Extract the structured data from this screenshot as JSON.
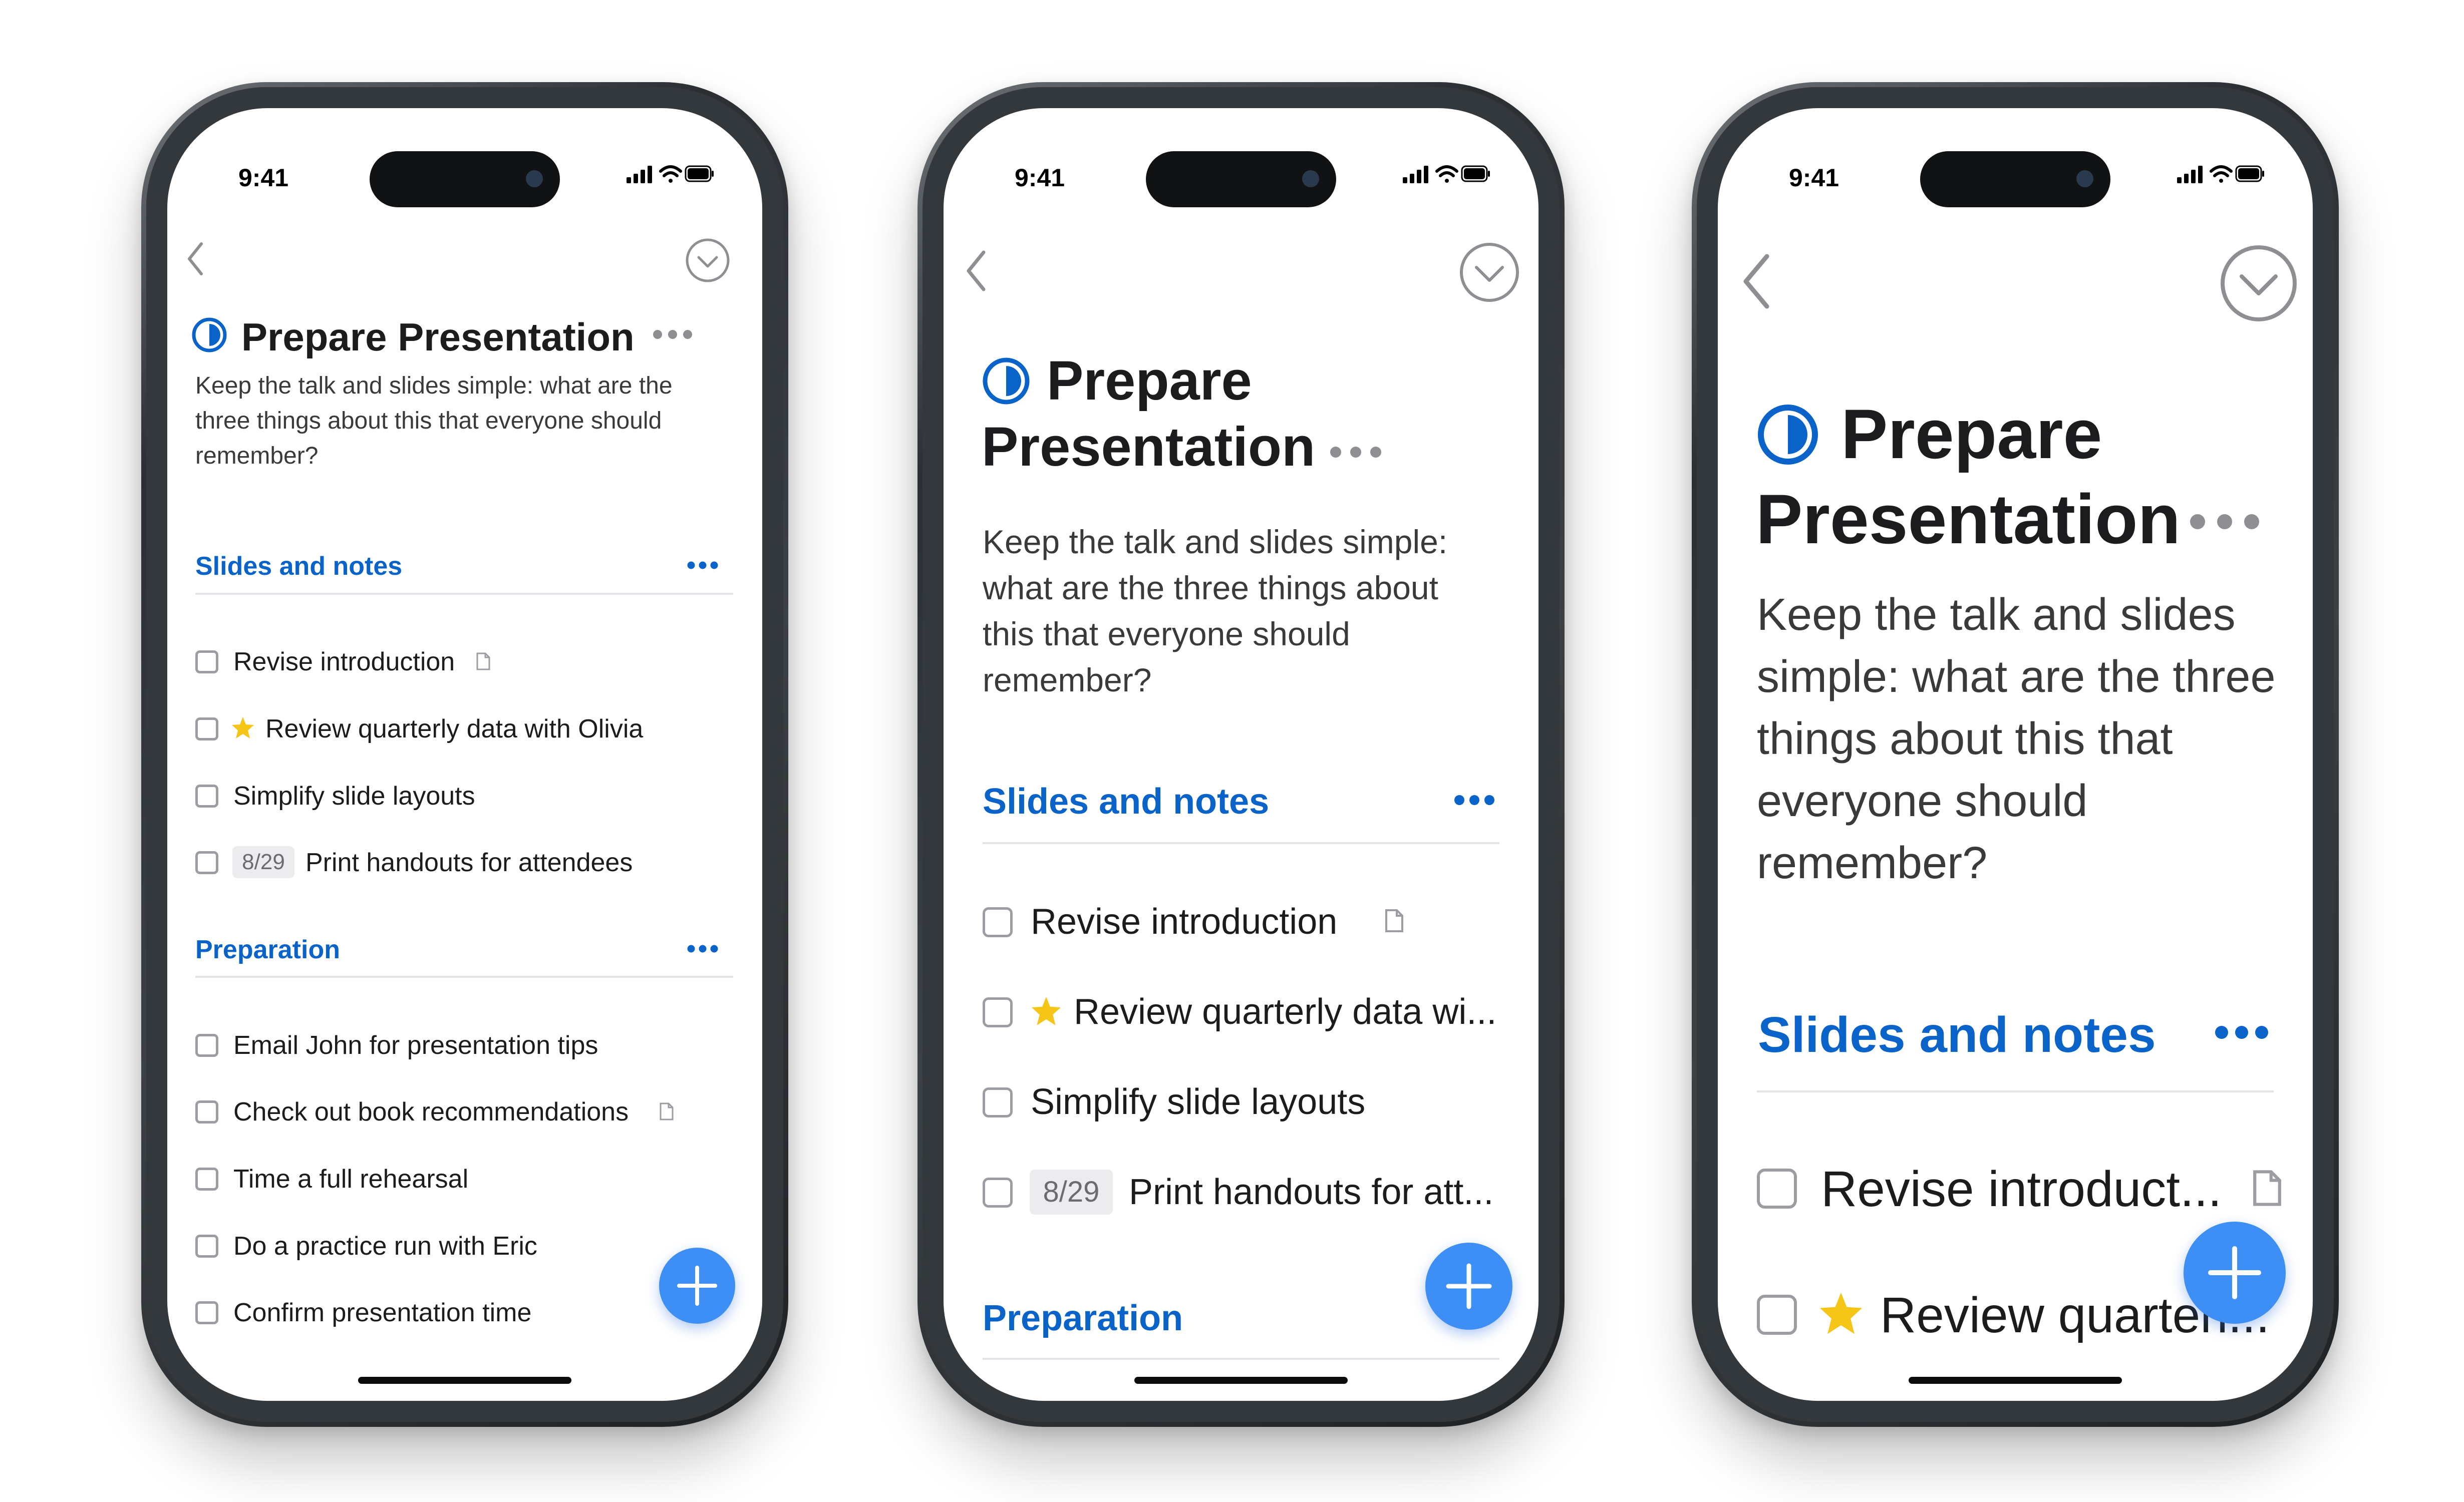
{
  "status": {
    "time": "9:41"
  },
  "task": {
    "title": "Prepare Presentation",
    "title_line1": "Prepare",
    "title_line2": "Presentation",
    "description": "Keep the talk and slides simple: what are the three things about this that everyone should remember?"
  },
  "sections": [
    {
      "title": "Slides and notes",
      "items": [
        {
          "text": "Revise introduction",
          "short_md": "Revise introduction",
          "short_lg": "Revise introduct...",
          "icon": "note-icon"
        },
        {
          "text": "Review quarterly data with Olivia",
          "short_md": "Review quarterly data wi...",
          "short_lg": "Review quarterl...",
          "icon": "star-icon"
        },
        {
          "text": "Simplify slide layouts"
        },
        {
          "text": "Print handouts for attendees",
          "short_md": "Print handouts for att...",
          "date": "8/29"
        }
      ]
    },
    {
      "title": "Preparation",
      "items": [
        {
          "text": "Email John for presentation tips"
        },
        {
          "text": "Check out book recommendations",
          "icon": "note-icon"
        },
        {
          "text": "Time a full rehearsal"
        },
        {
          "text": "Do a practice run with Eric"
        },
        {
          "text": "Confirm presentation time"
        }
      ]
    }
  ],
  "colors": {
    "accent": "#0a63c9",
    "fab": "#3d8ef5",
    "star": "#f5c518"
  }
}
